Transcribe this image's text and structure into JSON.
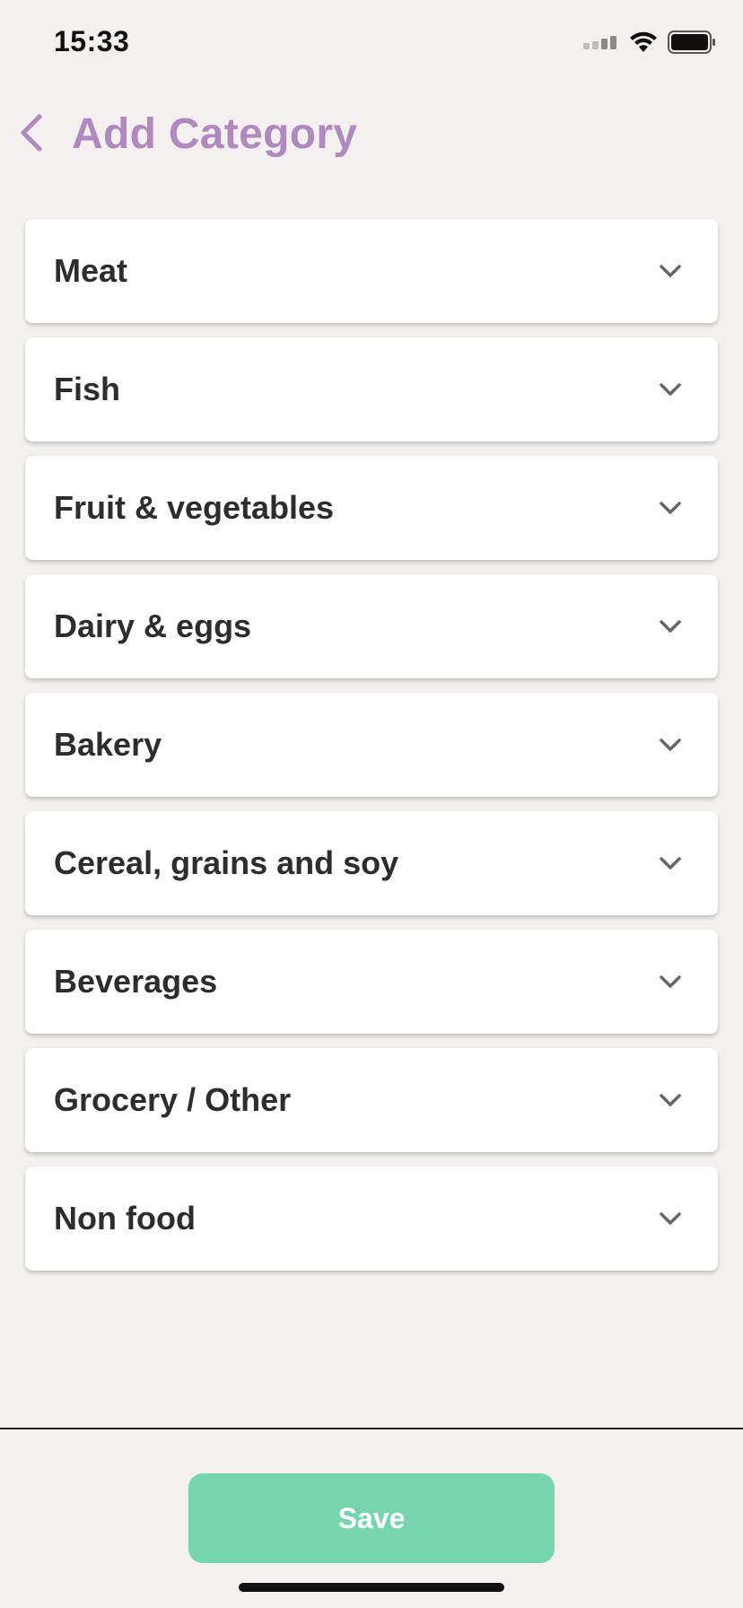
{
  "status_bar": {
    "time": "15:33",
    "icons": [
      "signal-icon",
      "wifi-icon",
      "battery-icon"
    ]
  },
  "header": {
    "back_icon": "chevron-left-icon",
    "title": "Add Category"
  },
  "categories": [
    {
      "label": "Meat"
    },
    {
      "label": "Fish"
    },
    {
      "label": "Fruit & vegetables"
    },
    {
      "label": "Dairy & eggs"
    },
    {
      "label": "Bakery"
    },
    {
      "label": "Cereal, grains and soy"
    },
    {
      "label": "Beverages"
    },
    {
      "label": "Grocery / Other"
    },
    {
      "label": "Non food"
    }
  ],
  "footer": {
    "save_label": "Save"
  },
  "colors": {
    "background": "#f4f0f0",
    "title_accent": "#b089be",
    "save_button": "#76d4ae",
    "card": "#ffffff",
    "text": "#2d2d2d"
  }
}
